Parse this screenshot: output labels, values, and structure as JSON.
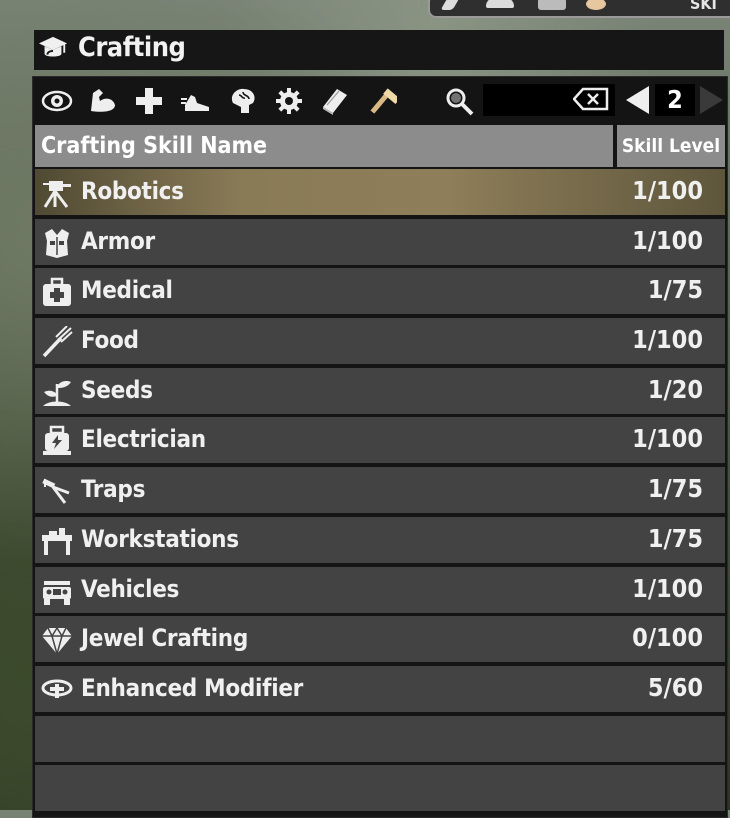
{
  "window": {
    "title": "Crafting",
    "top_tab_partial_text": "SKI"
  },
  "toolbar": {
    "filters": [
      {
        "icon": "eye-icon",
        "name": "filter-perception"
      },
      {
        "icon": "muscle-icon",
        "name": "filter-strength"
      },
      {
        "icon": "plus-icon",
        "name": "filter-fortitude"
      },
      {
        "icon": "shoe-icon",
        "name": "filter-agility"
      },
      {
        "icon": "brain-icon",
        "name": "filter-intellect"
      },
      {
        "icon": "gear-icon",
        "name": "filter-general"
      },
      {
        "icon": "book-icon",
        "name": "filter-books"
      },
      {
        "icon": "hammer-icon",
        "name": "filter-crafting"
      }
    ],
    "search": {
      "value": "",
      "placeholder": ""
    },
    "page": "2"
  },
  "table": {
    "headers": {
      "name": "Crafting Skill Name",
      "level": "Skill Level"
    },
    "rows": [
      {
        "name": "Robotics",
        "level": "1/100",
        "icon": "robot-turret-icon",
        "selected": true
      },
      {
        "name": "Armor",
        "level": "1/100",
        "icon": "armor-vest-icon"
      },
      {
        "name": "Medical",
        "level": "1/75",
        "icon": "medkit-icon"
      },
      {
        "name": "Food",
        "level": "1/100",
        "icon": "fork-icon"
      },
      {
        "name": "Seeds",
        "level": "1/20",
        "icon": "sprout-icon"
      },
      {
        "name": "Electrician",
        "level": "1/100",
        "icon": "generator-icon"
      },
      {
        "name": "Traps",
        "level": "1/75",
        "icon": "trap-icon"
      },
      {
        "name": "Workstations",
        "level": "1/75",
        "icon": "workbench-icon"
      },
      {
        "name": "Vehicles",
        "level": "1/100",
        "icon": "jeep-icon"
      },
      {
        "name": "Jewel Crafting",
        "level": "0/100",
        "icon": "diamond-icon"
      },
      {
        "name": "Enhanced Modifier",
        "level": "5/60",
        "icon": "modifier-icon"
      }
    ]
  },
  "colors": {
    "selected_row": "#8a7b57",
    "row": "#434343",
    "header": "#8c8c8c",
    "panel": "#141414"
  }
}
